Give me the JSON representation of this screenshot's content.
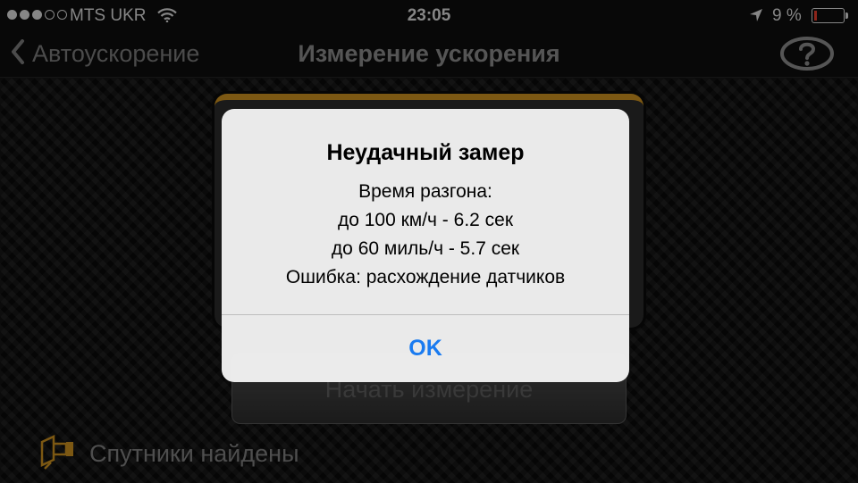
{
  "status_bar": {
    "carrier": "MTS UKR",
    "time": "23:05",
    "battery_text": "9 %",
    "battery_level": 0.09,
    "battery_color": "#e23a2a",
    "signal_bars_filled": 3,
    "signal_bars_total": 5,
    "icons": [
      "wifi-icon",
      "location-arrow-icon",
      "battery-icon"
    ]
  },
  "nav": {
    "back_label": "Автоускорение",
    "title": "Измерение ускорения",
    "help_icon": "question-circle-icon"
  },
  "main": {
    "start_button_label": "Начать измерение",
    "satellite_status": "Спутники найдены",
    "satellite_icon": "satellite-antenna-icon",
    "accent_color": "#c98f1f"
  },
  "alert": {
    "title": "Неудачный замер",
    "lines": [
      "Время разгона:",
      "до 100 км/ч - 6.2 сек",
      "до 60 миль/ч - 5.7 сек",
      "Ошибка: расхождение датчиков"
    ],
    "ok_label": "OK",
    "ok_color": "#1a7bf0"
  }
}
